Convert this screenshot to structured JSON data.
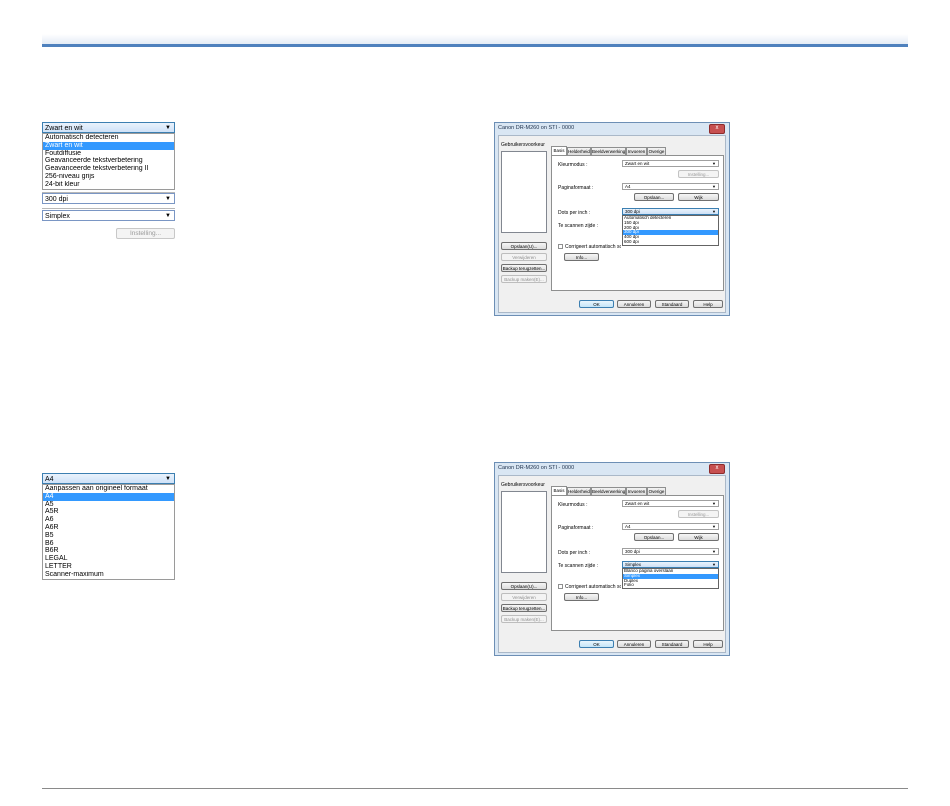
{
  "crop_color": {
    "selected": "Zwart en wit",
    "options": [
      "Automatisch detecteren",
      "Zwart en wit",
      "Foutdiffusie",
      "Geavanceerde tekstverbetering",
      "Geavanceerde tekstverbetering II",
      "256-niveau grijs",
      "24-bit kleur"
    ],
    "selected_index": 1,
    "dpi": "300 dpi",
    "side": "Simplex",
    "setting_button": "Instelling..."
  },
  "crop_page": {
    "selected": "A4",
    "options": [
      "Aanpassen aan origineel formaat",
      "A4",
      "A5",
      "A5R",
      "A6",
      "A6R",
      "B5",
      "B6",
      "B6R",
      "LEGAL",
      "LETTER",
      "Scanner-maximum"
    ],
    "selected_index": 1
  },
  "dialog": {
    "title": "Canon DR-M260 on STI - 0000",
    "profiles_label": "Gebruikersvoorkeur",
    "tabs": [
      "Basis",
      "Helderheid",
      "Beeldverwerking",
      "Invoeren",
      "Overige"
    ],
    "add_button": "Opslaan(U)...",
    "delete_button": "Verwijderen",
    "backup_restore_button": "Backup terugzetten...",
    "backup_make_button": "Backup maken(E)...",
    "color_mode_label": "Kleurmodus :",
    "color_mode_value": "Zwart en wit",
    "setting_button": "Instelling...",
    "page_size_label": "Paginaformaat :",
    "page_size_value": "A4",
    "save_button": "Opslaan...",
    "delete_small_button": "Wijk",
    "dpi_label": "Dots per inch :",
    "dpi_value": "300 dpi",
    "side_label": "Te scannen zijde :",
    "side_value": "Simplex",
    "deskew_label": "Corrigeert automatisch scheef ingevoerde documenten",
    "info_button": "Info...",
    "ok_button": "OK",
    "cancel_button": "Annuleren",
    "default_button": "Standaard",
    "help_button": "Help",
    "close_glyph": "x",
    "dpi_options": [
      "Automatisch detecteren",
      "150 dpi",
      "200 dpi",
      "300 dpi",
      "400 dpi",
      "600 dpi"
    ],
    "dpi_selected_index": 3,
    "side_options": [
      "Blanco pagina overslaan",
      "Simplex",
      "Duplex",
      "Folio"
    ],
    "side_selected_index": 1
  },
  "icons": {
    "dropdown": "chevron-down-icon",
    "close": "close-icon"
  },
  "colors": {
    "accent_rule": "#4f81bd",
    "selection": "#3399ff"
  }
}
